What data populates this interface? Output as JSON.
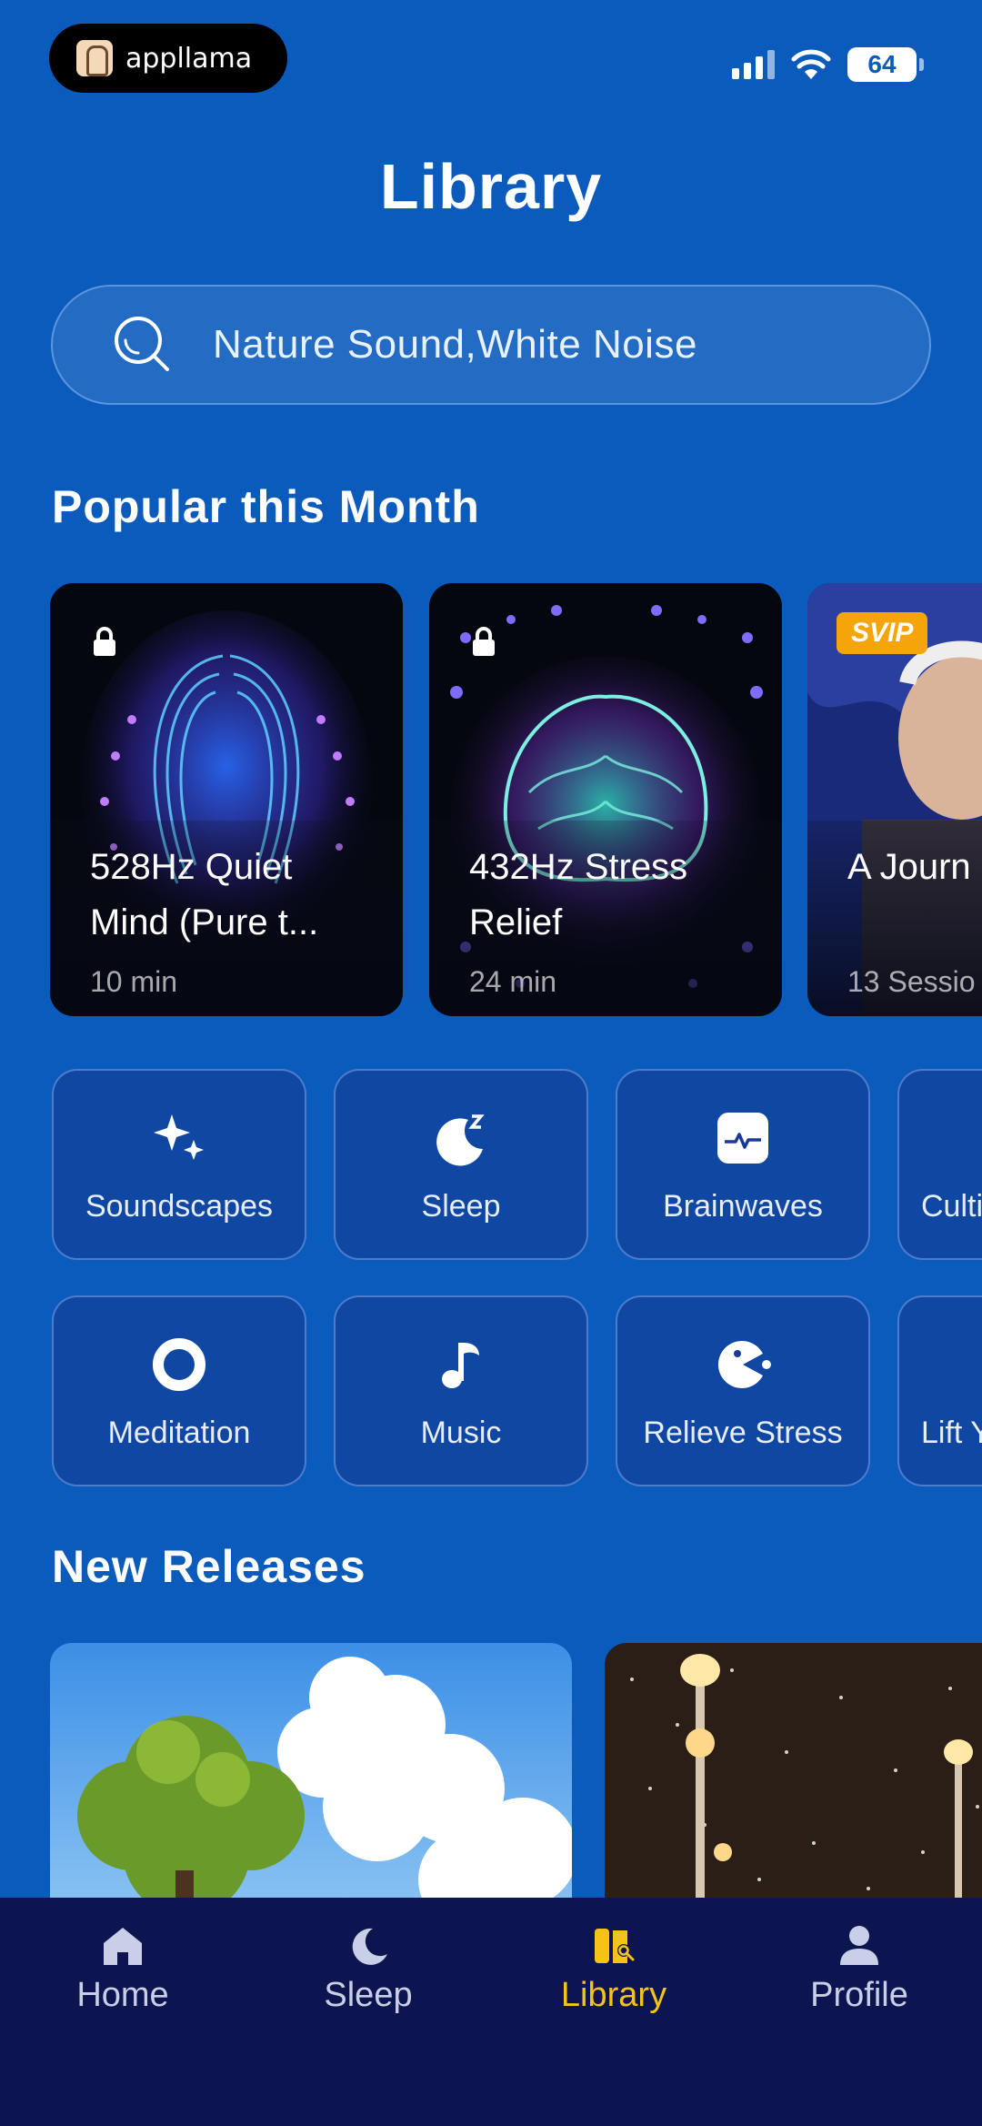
{
  "status_bar": {
    "app_name": "appllama",
    "battery": "64"
  },
  "header": {
    "title": "Library"
  },
  "search": {
    "placeholder": "Nature Sound,White Noise"
  },
  "popular": {
    "section_title": "Popular this Month",
    "cards": [
      {
        "title": "528Hz Quiet Mind (Pure t...",
        "meta": "10 min",
        "locked": true
      },
      {
        "title": "432Hz Stress Relief",
        "meta": "24 min",
        "locked": true
      },
      {
        "title": "A Journ Inner P",
        "meta": "13 Sessio",
        "badge": "SVIP"
      }
    ]
  },
  "categories": {
    "row1": [
      {
        "label": "Soundscapes",
        "icon": "sparkles-icon"
      },
      {
        "label": "Sleep",
        "icon": "moon-zz-icon"
      },
      {
        "label": "Brainwaves",
        "icon": "wave-monitor-icon"
      },
      {
        "label": "Cultiv",
        "icon": ""
      }
    ],
    "row2": [
      {
        "label": "Meditation",
        "icon": "ring-icon"
      },
      {
        "label": "Music",
        "icon": "music-note-icon"
      },
      {
        "label": "Relieve Stress",
        "icon": "chomp-icon"
      },
      {
        "label": "Lift Y",
        "icon": ""
      }
    ]
  },
  "new_releases": {
    "section_title": "New Releases"
  },
  "tabbar": {
    "items": [
      {
        "label": "Home",
        "icon": "home-icon"
      },
      {
        "label": "Sleep",
        "icon": "moon-icon"
      },
      {
        "label": "Library",
        "icon": "library-icon",
        "active": true
      },
      {
        "label": "Profile",
        "icon": "person-icon"
      }
    ],
    "active_color": "#f5c318",
    "inactive_color": "#c9cfe6"
  },
  "colors": {
    "background": "#0b5bbd",
    "tabbar": "#0d1550",
    "svip_badge": "#f5a50a"
  }
}
